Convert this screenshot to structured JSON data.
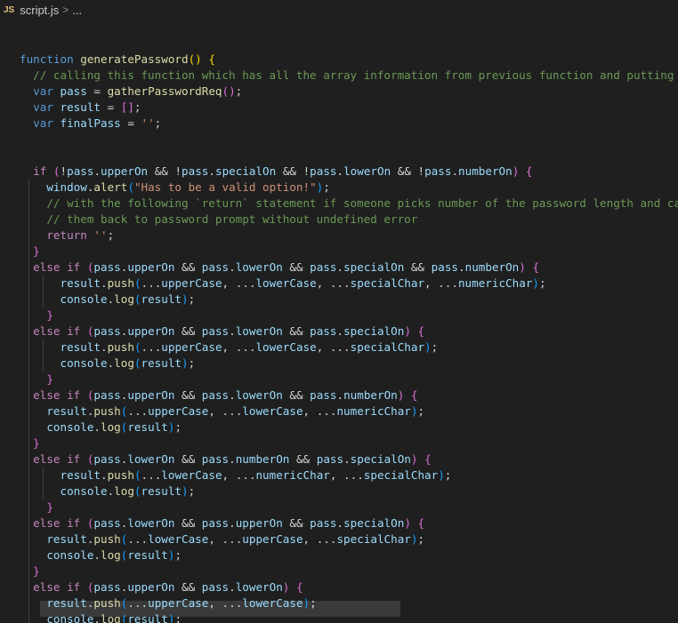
{
  "breadcrumb": {
    "lang_badge": "JS",
    "file": "script.js",
    "separator": ">",
    "more": "..."
  },
  "code": {
    "lines": [
      [
        [
          "fn-dummy",
          ""
        ]
      ],
      [],
      [
        [
          "kw",
          "function "
        ],
        [
          "fn",
          "generatePassword"
        ],
        [
          "br1",
          "() {"
        ]
      ],
      [
        [
          "cmt",
          "  // calling this function which has all the array information from previous function and putting this"
        ]
      ],
      [
        [
          "kw",
          "  var "
        ],
        [
          "var",
          "pass"
        ],
        [
          "pun",
          " = "
        ],
        [
          "fn",
          "gatherPasswordReq"
        ],
        [
          "br2",
          "()"
        ],
        [
          "pun",
          ";"
        ]
      ],
      [
        [
          "kw",
          "  var "
        ],
        [
          "var",
          "result"
        ],
        [
          "pun",
          " = "
        ],
        [
          "br2",
          "[]"
        ],
        [
          "pun",
          ";"
        ]
      ],
      [
        [
          "kw",
          "  var "
        ],
        [
          "var",
          "finalPass"
        ],
        [
          "pun",
          " = "
        ],
        [
          "str",
          "''"
        ],
        [
          "pun",
          ";"
        ]
      ],
      [],
      [],
      [
        [
          "ctrl",
          "  if "
        ],
        [
          "br2",
          "("
        ],
        [
          "pun",
          "!"
        ],
        [
          "var",
          "pass"
        ],
        [
          "pun",
          "."
        ],
        [
          "prop",
          "upperOn"
        ],
        [
          "pun",
          " && !"
        ],
        [
          "var",
          "pass"
        ],
        [
          "pun",
          "."
        ],
        [
          "prop",
          "specialOn"
        ],
        [
          "pun",
          " && !"
        ],
        [
          "var",
          "pass"
        ],
        [
          "pun",
          "."
        ],
        [
          "prop",
          "lowerOn"
        ],
        [
          "pun",
          " && !"
        ],
        [
          "var",
          "pass"
        ],
        [
          "pun",
          "."
        ],
        [
          "prop",
          "numberOn"
        ],
        [
          "br2",
          ")"
        ],
        [
          "br2",
          " {"
        ]
      ],
      [
        [
          "var",
          "    window"
        ],
        [
          "pun",
          "."
        ],
        [
          "fn",
          "alert"
        ],
        [
          "br3",
          "("
        ],
        [
          "str",
          "\"Has to be a valid option!\""
        ],
        [
          "br3",
          ")"
        ],
        [
          "pun",
          ";"
        ]
      ],
      [
        [
          "cmt",
          "    // with the following `return` statement if someone picks number of the password length and cancel"
        ]
      ],
      [
        [
          "cmt",
          "    // them back to password prompt without undefined error"
        ]
      ],
      [
        [
          "ctrl",
          "    return "
        ],
        [
          "str",
          "''"
        ],
        [
          "pun",
          ";"
        ]
      ],
      [
        [
          "br2",
          "  }"
        ]
      ],
      [
        [
          "ctrl",
          "  else if "
        ],
        [
          "br2",
          "("
        ],
        [
          "var",
          "pass"
        ],
        [
          "pun",
          "."
        ],
        [
          "prop",
          "upperOn"
        ],
        [
          "pun",
          " && "
        ],
        [
          "var",
          "pass"
        ],
        [
          "pun",
          "."
        ],
        [
          "prop",
          "lowerOn"
        ],
        [
          "pun",
          " && "
        ],
        [
          "var",
          "pass"
        ],
        [
          "pun",
          "."
        ],
        [
          "prop",
          "specialOn"
        ],
        [
          "pun",
          " && "
        ],
        [
          "var",
          "pass"
        ],
        [
          "pun",
          "."
        ],
        [
          "prop",
          "numberOn"
        ],
        [
          "br2",
          ")"
        ],
        [
          "br2",
          " {"
        ]
      ],
      [
        [
          "var",
          "      result"
        ],
        [
          "pun",
          "."
        ],
        [
          "fn",
          "push"
        ],
        [
          "br3",
          "("
        ],
        [
          "pun",
          "..."
        ],
        [
          "var",
          "upperCase"
        ],
        [
          "pun",
          ", ..."
        ],
        [
          "var",
          "lowerCase"
        ],
        [
          "pun",
          ", ..."
        ],
        [
          "var",
          "specialChar"
        ],
        [
          "pun",
          ", ..."
        ],
        [
          "var",
          "numericChar"
        ],
        [
          "br3",
          ")"
        ],
        [
          "pun",
          ";"
        ]
      ],
      [
        [
          "var",
          "      console"
        ],
        [
          "pun",
          "."
        ],
        [
          "fn",
          "log"
        ],
        [
          "br3",
          "("
        ],
        [
          "var",
          "result"
        ],
        [
          "br3",
          ")"
        ],
        [
          "pun",
          ";"
        ]
      ],
      [
        [
          "br2",
          "    }"
        ]
      ],
      [
        [
          "ctrl",
          "  else if "
        ],
        [
          "br2",
          "("
        ],
        [
          "var",
          "pass"
        ],
        [
          "pun",
          "."
        ],
        [
          "prop",
          "upperOn"
        ],
        [
          "pun",
          " && "
        ],
        [
          "var",
          "pass"
        ],
        [
          "pun",
          "."
        ],
        [
          "prop",
          "lowerOn"
        ],
        [
          "pun",
          " && "
        ],
        [
          "var",
          "pass"
        ],
        [
          "pun",
          "."
        ],
        [
          "prop",
          "specialOn"
        ],
        [
          "br2",
          ")"
        ],
        [
          "br2",
          " {"
        ]
      ],
      [
        [
          "var",
          "      result"
        ],
        [
          "pun",
          "."
        ],
        [
          "fn",
          "push"
        ],
        [
          "br3",
          "("
        ],
        [
          "pun",
          "..."
        ],
        [
          "var",
          "upperCase"
        ],
        [
          "pun",
          ", ..."
        ],
        [
          "var",
          "lowerCase"
        ],
        [
          "pun",
          ", ..."
        ],
        [
          "var",
          "specialChar"
        ],
        [
          "br3",
          ")"
        ],
        [
          "pun",
          ";"
        ]
      ],
      [
        [
          "var",
          "      console"
        ],
        [
          "pun",
          "."
        ],
        [
          "fn",
          "log"
        ],
        [
          "br3",
          "("
        ],
        [
          "var",
          "result"
        ],
        [
          "br3",
          ")"
        ],
        [
          "pun",
          ";"
        ]
      ],
      [
        [
          "br2",
          "    }"
        ]
      ],
      [
        [
          "ctrl",
          "  else if "
        ],
        [
          "br2",
          "("
        ],
        [
          "var",
          "pass"
        ],
        [
          "pun",
          "."
        ],
        [
          "prop",
          "upperOn"
        ],
        [
          "pun",
          " && "
        ],
        [
          "var",
          "pass"
        ],
        [
          "pun",
          "."
        ],
        [
          "prop",
          "lowerOn"
        ],
        [
          "pun",
          " && "
        ],
        [
          "var",
          "pass"
        ],
        [
          "pun",
          "."
        ],
        [
          "prop",
          "numberOn"
        ],
        [
          "br2",
          ")"
        ],
        [
          "br2",
          " {"
        ]
      ],
      [
        [
          "var",
          "    result"
        ],
        [
          "pun",
          "."
        ],
        [
          "fn",
          "push"
        ],
        [
          "br3",
          "("
        ],
        [
          "pun",
          "..."
        ],
        [
          "var",
          "upperCase"
        ],
        [
          "pun",
          ", ..."
        ],
        [
          "var",
          "lowerCase"
        ],
        [
          "pun",
          ", ..."
        ],
        [
          "var",
          "numericChar"
        ],
        [
          "br3",
          ")"
        ],
        [
          "pun",
          ";"
        ]
      ],
      [
        [
          "var",
          "    console"
        ],
        [
          "pun",
          "."
        ],
        [
          "fn",
          "log"
        ],
        [
          "br3",
          "("
        ],
        [
          "var",
          "result"
        ],
        [
          "br3",
          ")"
        ],
        [
          "pun",
          ";"
        ]
      ],
      [
        [
          "br2",
          "  }"
        ]
      ],
      [
        [
          "ctrl",
          "  else if "
        ],
        [
          "br2",
          "("
        ],
        [
          "var",
          "pass"
        ],
        [
          "pun",
          "."
        ],
        [
          "prop",
          "lowerOn"
        ],
        [
          "pun",
          " && "
        ],
        [
          "var",
          "pass"
        ],
        [
          "pun",
          "."
        ],
        [
          "prop",
          "numberOn"
        ],
        [
          "pun",
          " && "
        ],
        [
          "var",
          "pass"
        ],
        [
          "pun",
          "."
        ],
        [
          "prop",
          "specialOn"
        ],
        [
          "br2",
          ")"
        ],
        [
          "br2",
          " {"
        ]
      ],
      [
        [
          "var",
          "      result"
        ],
        [
          "pun",
          "."
        ],
        [
          "fn",
          "push"
        ],
        [
          "br3",
          "("
        ],
        [
          "pun",
          "..."
        ],
        [
          "var",
          "lowerCase"
        ],
        [
          "pun",
          ", ..."
        ],
        [
          "var",
          "numericChar"
        ],
        [
          "pun",
          ", ..."
        ],
        [
          "var",
          "specialChar"
        ],
        [
          "br3",
          ")"
        ],
        [
          "pun",
          ";"
        ]
      ],
      [
        [
          "var",
          "      console"
        ],
        [
          "pun",
          "."
        ],
        [
          "fn",
          "log"
        ],
        [
          "br3",
          "("
        ],
        [
          "var",
          "result"
        ],
        [
          "br3",
          ")"
        ],
        [
          "pun",
          ";"
        ]
      ],
      [
        [
          "br2",
          "    }"
        ]
      ],
      [
        [
          "ctrl",
          "  else if "
        ],
        [
          "br2",
          "("
        ],
        [
          "var",
          "pass"
        ],
        [
          "pun",
          "."
        ],
        [
          "prop",
          "lowerOn"
        ],
        [
          "pun",
          " && "
        ],
        [
          "var",
          "pass"
        ],
        [
          "pun",
          "."
        ],
        [
          "prop",
          "upperOn"
        ],
        [
          "pun",
          " && "
        ],
        [
          "var",
          "pass"
        ],
        [
          "pun",
          "."
        ],
        [
          "prop",
          "specialOn"
        ],
        [
          "br2",
          ")"
        ],
        [
          "br2",
          " {"
        ]
      ],
      [
        [
          "var",
          "    result"
        ],
        [
          "pun",
          "."
        ],
        [
          "fn",
          "push"
        ],
        [
          "br3",
          "("
        ],
        [
          "pun",
          "..."
        ],
        [
          "var",
          "lowerCase"
        ],
        [
          "pun",
          ", ..."
        ],
        [
          "var",
          "upperCase"
        ],
        [
          "pun",
          ", ..."
        ],
        [
          "var",
          "specialChar"
        ],
        [
          "br3",
          ")"
        ],
        [
          "pun",
          ";"
        ]
      ],
      [
        [
          "var",
          "    console"
        ],
        [
          "pun",
          "."
        ],
        [
          "fn",
          "log"
        ],
        [
          "br3",
          "("
        ],
        [
          "var",
          "result"
        ],
        [
          "br3",
          ")"
        ],
        [
          "pun",
          ";"
        ]
      ],
      [
        [
          "br2",
          "  }"
        ]
      ],
      [
        [
          "ctrl",
          "  else if "
        ],
        [
          "br2",
          "("
        ],
        [
          "var",
          "pass"
        ],
        [
          "pun",
          "."
        ],
        [
          "prop",
          "upperOn"
        ],
        [
          "pun",
          " && "
        ],
        [
          "var",
          "pass"
        ],
        [
          "pun",
          "."
        ],
        [
          "prop",
          "lowerOn"
        ],
        [
          "br2",
          ")"
        ],
        [
          "br2",
          " {"
        ]
      ],
      [
        [
          "var",
          "    result"
        ],
        [
          "pun",
          "."
        ],
        [
          "fn",
          "push"
        ],
        [
          "br3",
          "("
        ],
        [
          "pun",
          "..."
        ],
        [
          "var",
          "upperCase"
        ],
        [
          "pun",
          ", ..."
        ],
        [
          "var",
          "lowerCase"
        ],
        [
          "br3",
          ")"
        ],
        [
          "pun",
          ";"
        ]
      ],
      [
        [
          "var",
          "    console"
        ],
        [
          "pun",
          "."
        ],
        [
          "fn",
          "log"
        ],
        [
          "br3",
          "("
        ],
        [
          "var",
          "result"
        ],
        [
          "br3",
          ")"
        ],
        [
          "pun",
          ";"
        ]
      ]
    ]
  },
  "colors": {
    "background": "#1f1f1f",
    "keyword": "#569cd6",
    "control": "#c586c0",
    "function": "#dcdcaa",
    "variable": "#9cdcfe",
    "string": "#ce9178",
    "comment": "#6a9955",
    "bracket_gold": "#ffd700",
    "bracket_magenta": "#da70d6",
    "bracket_blue": "#179fff",
    "js_badge": "#e5c07b"
  }
}
